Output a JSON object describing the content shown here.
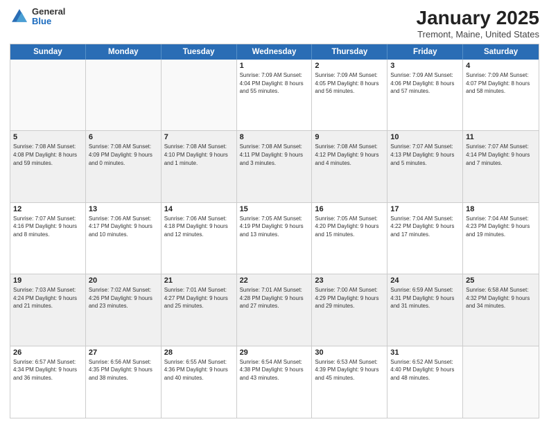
{
  "header": {
    "logo_general": "General",
    "logo_blue": "Blue",
    "month_year": "January 2025",
    "location": "Tremont, Maine, United States"
  },
  "weekdays": [
    "Sunday",
    "Monday",
    "Tuesday",
    "Wednesday",
    "Thursday",
    "Friday",
    "Saturday"
  ],
  "weeks": [
    [
      {
        "day": "",
        "info": "",
        "empty": true,
        "shaded": false
      },
      {
        "day": "",
        "info": "",
        "empty": true,
        "shaded": false
      },
      {
        "day": "",
        "info": "",
        "empty": true,
        "shaded": false
      },
      {
        "day": "1",
        "info": "Sunrise: 7:09 AM\nSunset: 4:04 PM\nDaylight: 8 hours\nand 55 minutes.",
        "empty": false,
        "shaded": false
      },
      {
        "day": "2",
        "info": "Sunrise: 7:09 AM\nSunset: 4:05 PM\nDaylight: 8 hours\nand 56 minutes.",
        "empty": false,
        "shaded": false
      },
      {
        "day": "3",
        "info": "Sunrise: 7:09 AM\nSunset: 4:06 PM\nDaylight: 8 hours\nand 57 minutes.",
        "empty": false,
        "shaded": false
      },
      {
        "day": "4",
        "info": "Sunrise: 7:09 AM\nSunset: 4:07 PM\nDaylight: 8 hours\nand 58 minutes.",
        "empty": false,
        "shaded": false
      }
    ],
    [
      {
        "day": "5",
        "info": "Sunrise: 7:08 AM\nSunset: 4:08 PM\nDaylight: 8 hours\nand 59 minutes.",
        "empty": false,
        "shaded": true
      },
      {
        "day": "6",
        "info": "Sunrise: 7:08 AM\nSunset: 4:09 PM\nDaylight: 9 hours\nand 0 minutes.",
        "empty": false,
        "shaded": true
      },
      {
        "day": "7",
        "info": "Sunrise: 7:08 AM\nSunset: 4:10 PM\nDaylight: 9 hours\nand 1 minute.",
        "empty": false,
        "shaded": true
      },
      {
        "day": "8",
        "info": "Sunrise: 7:08 AM\nSunset: 4:11 PM\nDaylight: 9 hours\nand 3 minutes.",
        "empty": false,
        "shaded": true
      },
      {
        "day": "9",
        "info": "Sunrise: 7:08 AM\nSunset: 4:12 PM\nDaylight: 9 hours\nand 4 minutes.",
        "empty": false,
        "shaded": true
      },
      {
        "day": "10",
        "info": "Sunrise: 7:07 AM\nSunset: 4:13 PM\nDaylight: 9 hours\nand 5 minutes.",
        "empty": false,
        "shaded": true
      },
      {
        "day": "11",
        "info": "Sunrise: 7:07 AM\nSunset: 4:14 PM\nDaylight: 9 hours\nand 7 minutes.",
        "empty": false,
        "shaded": true
      }
    ],
    [
      {
        "day": "12",
        "info": "Sunrise: 7:07 AM\nSunset: 4:16 PM\nDaylight: 9 hours\nand 8 minutes.",
        "empty": false,
        "shaded": false
      },
      {
        "day": "13",
        "info": "Sunrise: 7:06 AM\nSunset: 4:17 PM\nDaylight: 9 hours\nand 10 minutes.",
        "empty": false,
        "shaded": false
      },
      {
        "day": "14",
        "info": "Sunrise: 7:06 AM\nSunset: 4:18 PM\nDaylight: 9 hours\nand 12 minutes.",
        "empty": false,
        "shaded": false
      },
      {
        "day": "15",
        "info": "Sunrise: 7:05 AM\nSunset: 4:19 PM\nDaylight: 9 hours\nand 13 minutes.",
        "empty": false,
        "shaded": false
      },
      {
        "day": "16",
        "info": "Sunrise: 7:05 AM\nSunset: 4:20 PM\nDaylight: 9 hours\nand 15 minutes.",
        "empty": false,
        "shaded": false
      },
      {
        "day": "17",
        "info": "Sunrise: 7:04 AM\nSunset: 4:22 PM\nDaylight: 9 hours\nand 17 minutes.",
        "empty": false,
        "shaded": false
      },
      {
        "day": "18",
        "info": "Sunrise: 7:04 AM\nSunset: 4:23 PM\nDaylight: 9 hours\nand 19 minutes.",
        "empty": false,
        "shaded": false
      }
    ],
    [
      {
        "day": "19",
        "info": "Sunrise: 7:03 AM\nSunset: 4:24 PM\nDaylight: 9 hours\nand 21 minutes.",
        "empty": false,
        "shaded": true
      },
      {
        "day": "20",
        "info": "Sunrise: 7:02 AM\nSunset: 4:26 PM\nDaylight: 9 hours\nand 23 minutes.",
        "empty": false,
        "shaded": true
      },
      {
        "day": "21",
        "info": "Sunrise: 7:01 AM\nSunset: 4:27 PM\nDaylight: 9 hours\nand 25 minutes.",
        "empty": false,
        "shaded": true
      },
      {
        "day": "22",
        "info": "Sunrise: 7:01 AM\nSunset: 4:28 PM\nDaylight: 9 hours\nand 27 minutes.",
        "empty": false,
        "shaded": true
      },
      {
        "day": "23",
        "info": "Sunrise: 7:00 AM\nSunset: 4:29 PM\nDaylight: 9 hours\nand 29 minutes.",
        "empty": false,
        "shaded": true
      },
      {
        "day": "24",
        "info": "Sunrise: 6:59 AM\nSunset: 4:31 PM\nDaylight: 9 hours\nand 31 minutes.",
        "empty": false,
        "shaded": true
      },
      {
        "day": "25",
        "info": "Sunrise: 6:58 AM\nSunset: 4:32 PM\nDaylight: 9 hours\nand 34 minutes.",
        "empty": false,
        "shaded": true
      }
    ],
    [
      {
        "day": "26",
        "info": "Sunrise: 6:57 AM\nSunset: 4:34 PM\nDaylight: 9 hours\nand 36 minutes.",
        "empty": false,
        "shaded": false
      },
      {
        "day": "27",
        "info": "Sunrise: 6:56 AM\nSunset: 4:35 PM\nDaylight: 9 hours\nand 38 minutes.",
        "empty": false,
        "shaded": false
      },
      {
        "day": "28",
        "info": "Sunrise: 6:55 AM\nSunset: 4:36 PM\nDaylight: 9 hours\nand 40 minutes.",
        "empty": false,
        "shaded": false
      },
      {
        "day": "29",
        "info": "Sunrise: 6:54 AM\nSunset: 4:38 PM\nDaylight: 9 hours\nand 43 minutes.",
        "empty": false,
        "shaded": false
      },
      {
        "day": "30",
        "info": "Sunrise: 6:53 AM\nSunset: 4:39 PM\nDaylight: 9 hours\nand 45 minutes.",
        "empty": false,
        "shaded": false
      },
      {
        "day": "31",
        "info": "Sunrise: 6:52 AM\nSunset: 4:40 PM\nDaylight: 9 hours\nand 48 minutes.",
        "empty": false,
        "shaded": false
      },
      {
        "day": "",
        "info": "",
        "empty": true,
        "shaded": false
      }
    ]
  ]
}
